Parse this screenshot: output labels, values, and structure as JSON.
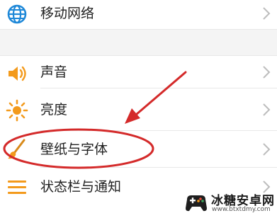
{
  "settings": {
    "items": [
      {
        "label": "移动网络",
        "icon": "globe-icon"
      },
      {
        "label": "声音",
        "icon": "speaker-icon"
      },
      {
        "label": "亮度",
        "icon": "sun-icon"
      },
      {
        "label": "壁纸与字体",
        "icon": "paintbrush-icon"
      },
      {
        "label": "状态栏与通知",
        "icon": "list-lines-icon"
      }
    ]
  },
  "annotation": {
    "highlighted_item": "壁纸与字体",
    "color": "#d42a2a"
  },
  "watermark": {
    "title": "冰糖安卓网",
    "url": "www.btxtdmy.com"
  },
  "colors": {
    "icon_blue": "#1e88d8",
    "icon_orange": "#f39a1c",
    "chevron": "#bdbdbd",
    "section_gap": "#f4f4f4"
  }
}
